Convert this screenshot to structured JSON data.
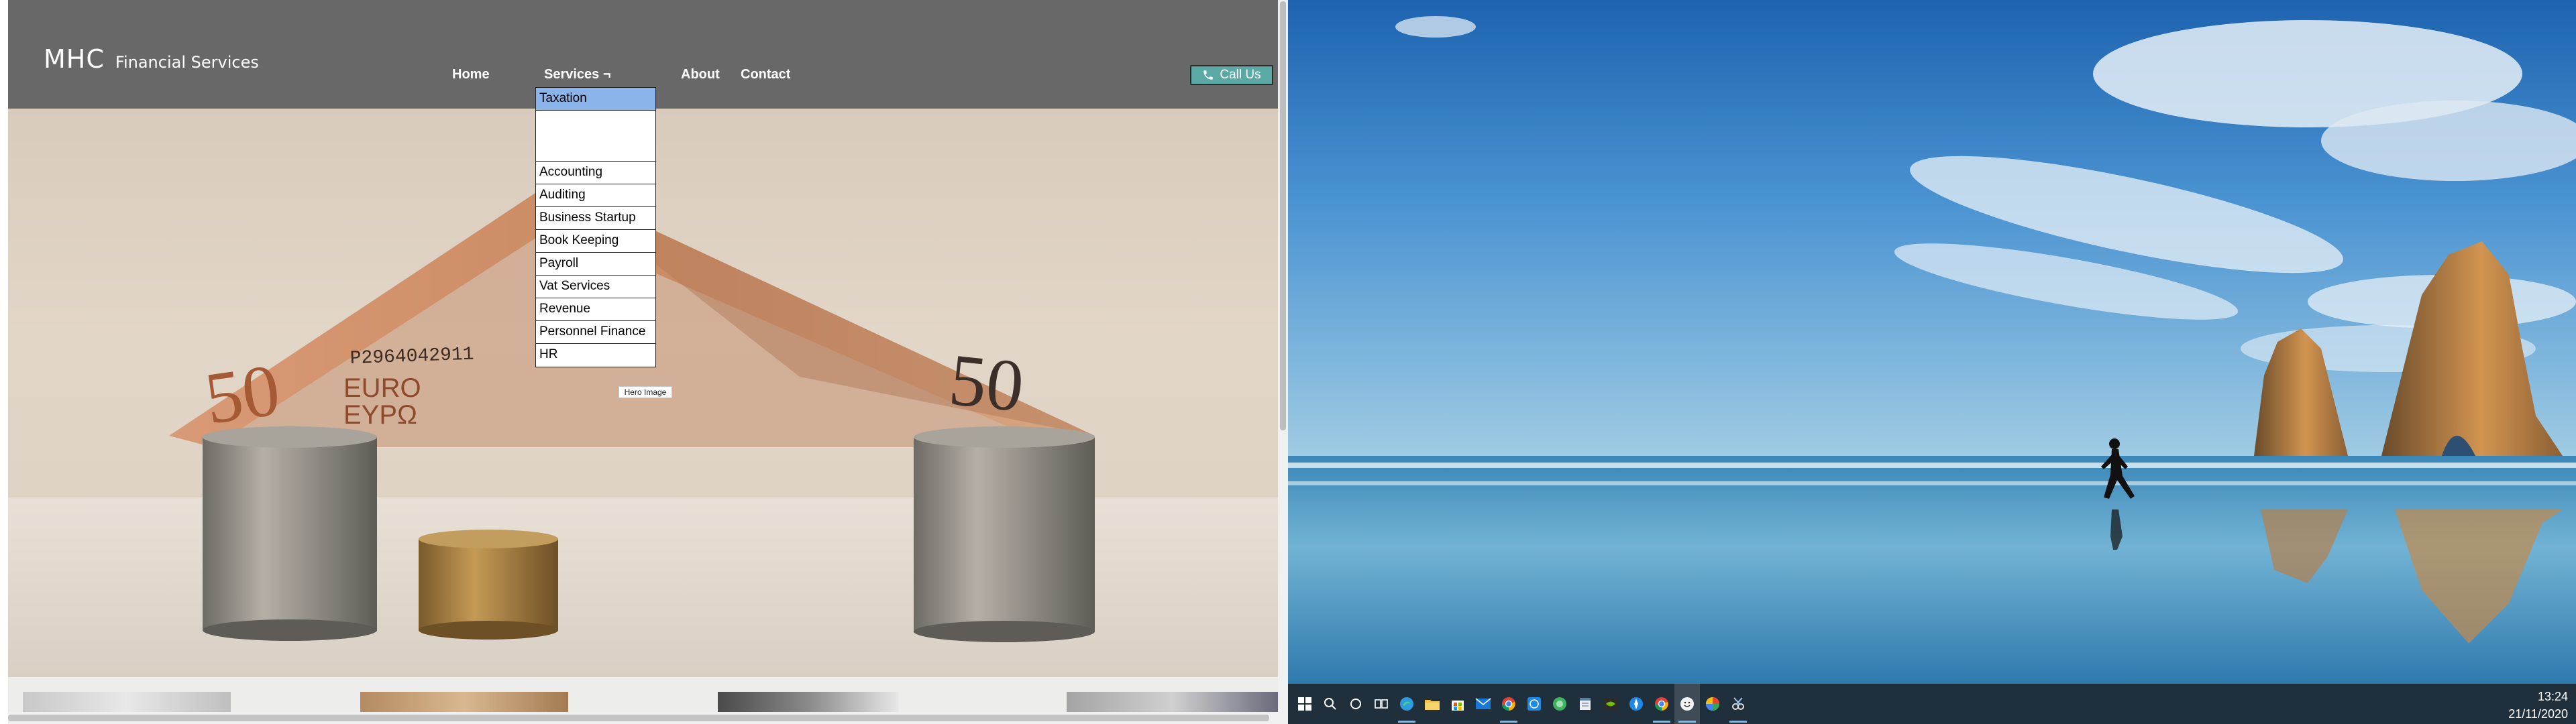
{
  "browser": {
    "site": {
      "logo_mark": "MHC",
      "logo_text": "Financial Services",
      "nav": {
        "home": "Home",
        "services": "Services ¬",
        "about": "About",
        "contact": "Contact"
      },
      "call_button": "Call Us",
      "hero_label": "Hero Image",
      "services_menu": {
        "items": [
          "Taxation",
          "",
          "Accounting",
          "Auditing",
          "Business Startup",
          "Book Keeping",
          "Payroll",
          "Vat Services",
          "Revenue",
          "Personnel Finance",
          "HR"
        ],
        "highlighted_item": "Taxation"
      },
      "banknote_text": {
        "serial": "P2964042911",
        "value_left": "50",
        "value_right": "50",
        "currency": "EURO",
        "currency_alt": "EYPΩ"
      }
    }
  },
  "desktop": {
    "taskbar": {
      "icons": [
        "windows-start-icon",
        "search-icon",
        "cortana-icon",
        "task-view-icon",
        "edge-icon",
        "file-explorer-icon",
        "store-icon",
        "mail-icon",
        "chrome-icon",
        "whatsapp-icon",
        "green-app-icon",
        "notepad-icon",
        "nvidia-icon",
        "browser-icon",
        "chrome-icon",
        "emoji-icon",
        "photos-icon",
        "snipping-tool-icon"
      ],
      "clock": {
        "time": "13:24",
        "date": "21/11/2020"
      }
    }
  },
  "colors": {
    "site_header": "#686868",
    "call_button": "#5aa9a5",
    "menu_highlight": "#8ab4ea",
    "taskbar": "#202f3c"
  }
}
